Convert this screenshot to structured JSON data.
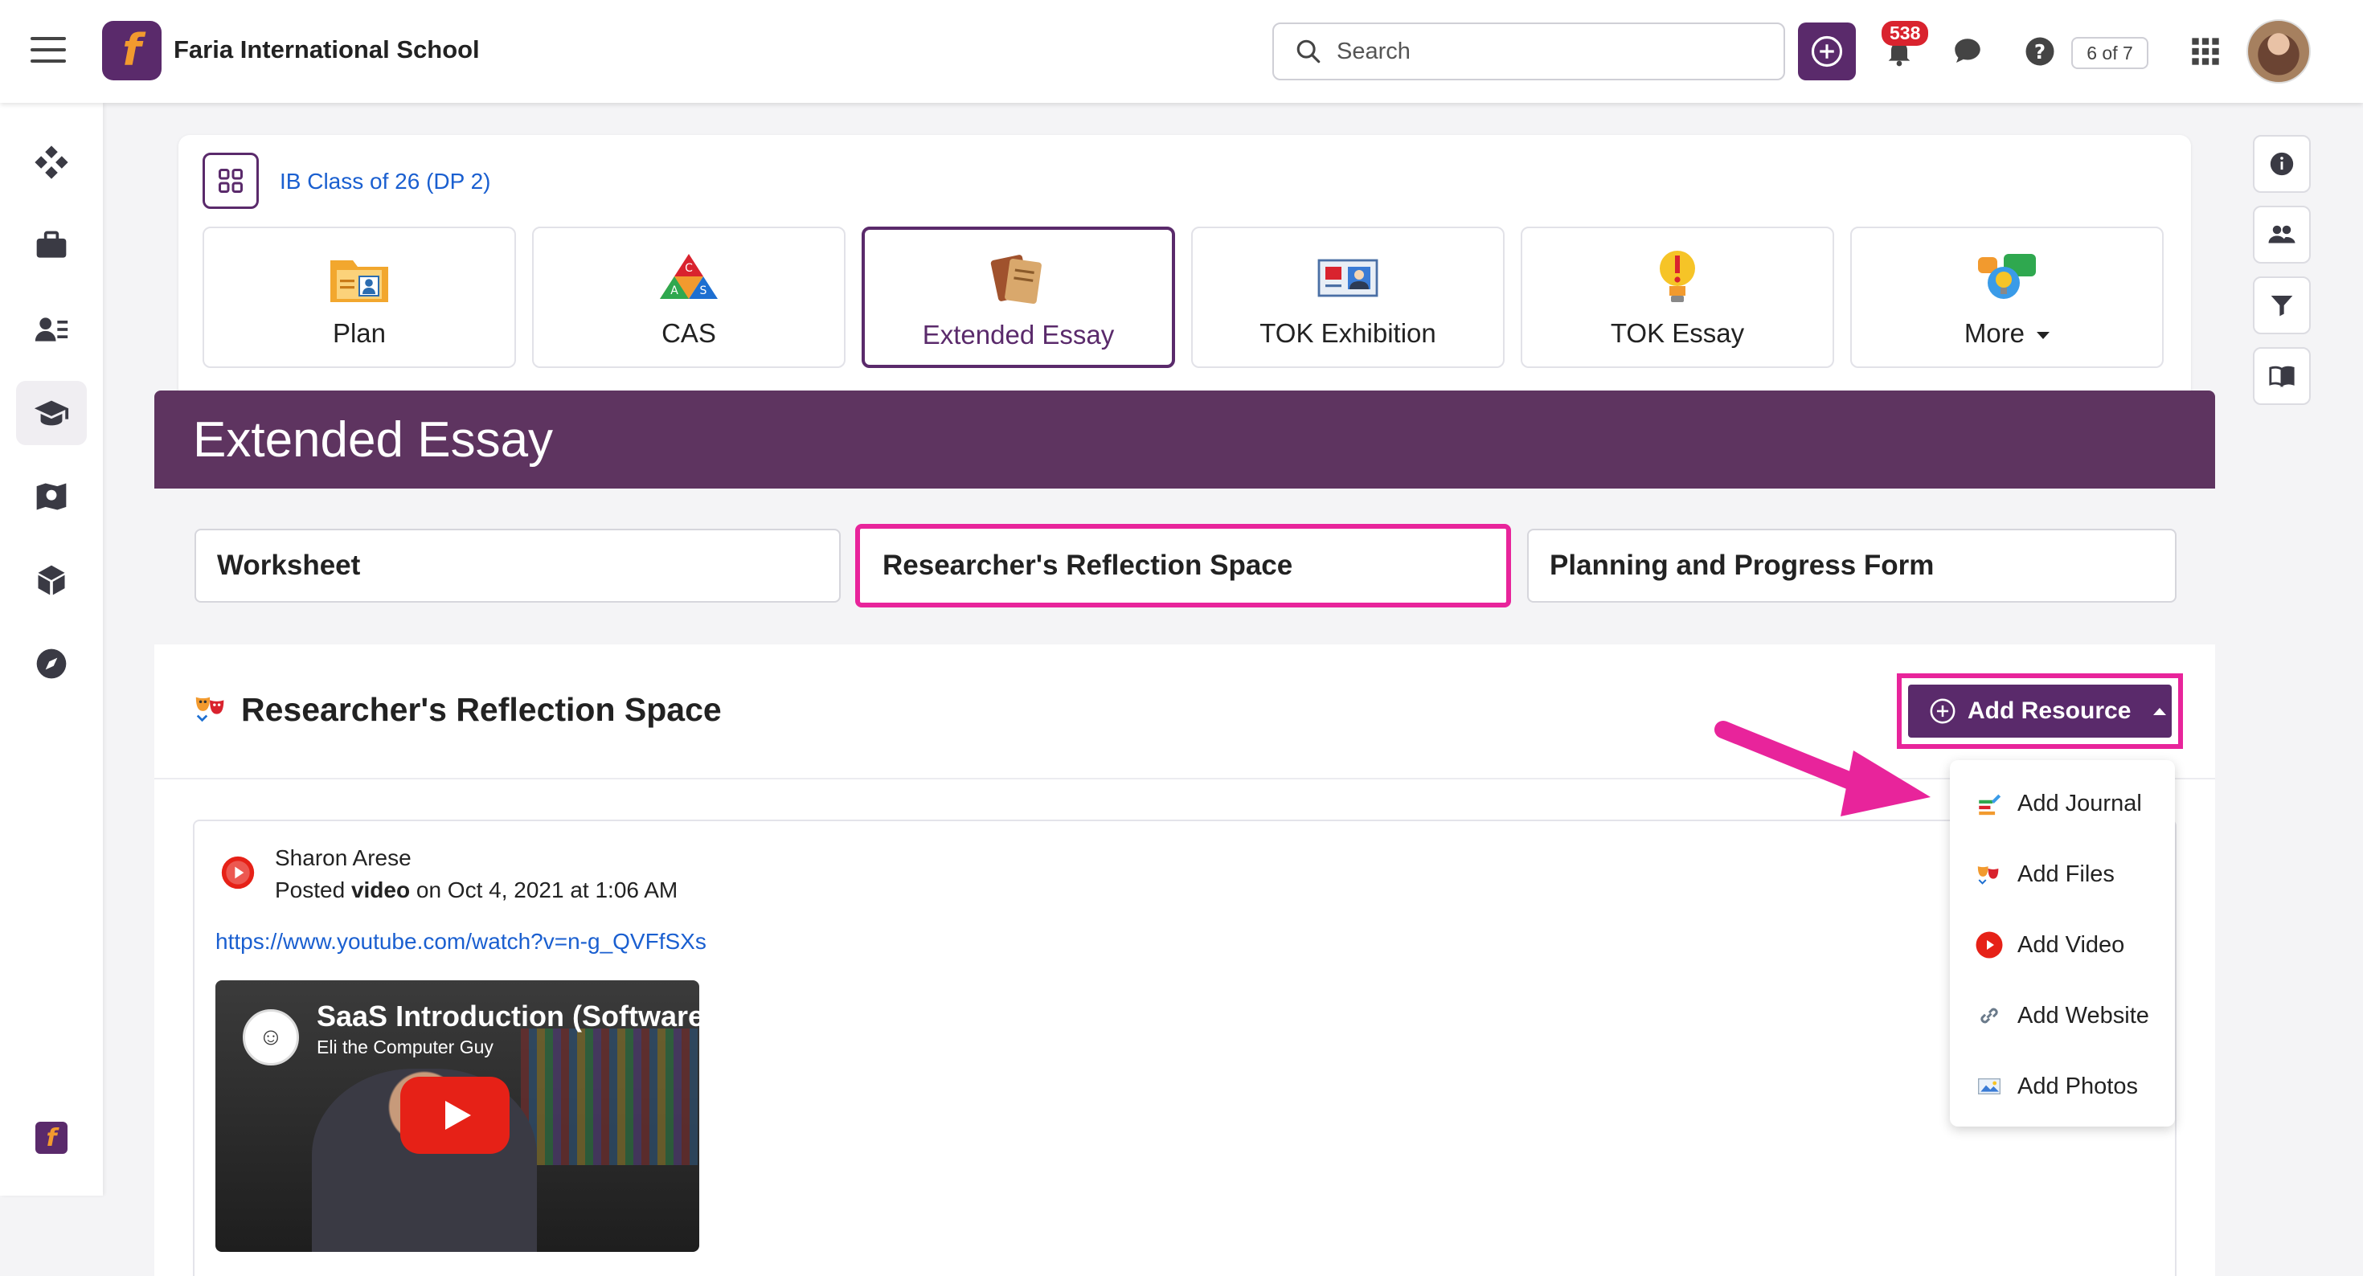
{
  "app": {
    "school_name": "Faria International School",
    "search_placeholder": "Search",
    "notifications_count": "538",
    "page_counter": "6 of 7",
    "accent": "#5a2a6b",
    "highlight": "#e8249b"
  },
  "class_card": {
    "class_link": "IB Class of 26 (DP 2)",
    "tiles": [
      {
        "label": "Plan",
        "icon": "plan-folder-icon"
      },
      {
        "label": "CAS",
        "icon": "cas-triangle-icon"
      },
      {
        "label": "Extended Essay",
        "icon": "essay-books-icon",
        "active": true
      },
      {
        "label": "TOK Exhibition",
        "icon": "tok-exhibition-icon"
      },
      {
        "label": "TOK Essay",
        "icon": "lightbulb-icon"
      },
      {
        "label": "More",
        "icon": "more-chat-icon"
      }
    ]
  },
  "banner": {
    "title": "Extended Essay"
  },
  "sub_tabs": [
    {
      "label": "Worksheet"
    },
    {
      "label": "Researcher's Reflection Space",
      "highlighted": true
    },
    {
      "label": "Planning and Progress Form"
    }
  ],
  "section": {
    "title": "Researcher's Reflection Space",
    "add_resource_label": "Add Resource"
  },
  "post": {
    "author": "Sharon Arese",
    "meta_prefix": "Posted ",
    "meta_type": "video",
    "meta_suffix": " on Oct 4, 2021 at 1:06 AM",
    "link": "https://www.youtube.com/watch?v=n-g_QVFfSXs",
    "video_title": "SaaS Introduction (Software",
    "video_channel": "Eli the Computer Guy"
  },
  "dropdown": {
    "items": [
      {
        "label": "Add Journal",
        "icon": "journal-icon"
      },
      {
        "label": "Add Files",
        "icon": "files-icon"
      },
      {
        "label": "Add Video",
        "icon": "video-play-icon"
      },
      {
        "label": "Add Website",
        "icon": "link-icon"
      },
      {
        "label": "Add Photos",
        "icon": "photo-icon"
      }
    ]
  }
}
